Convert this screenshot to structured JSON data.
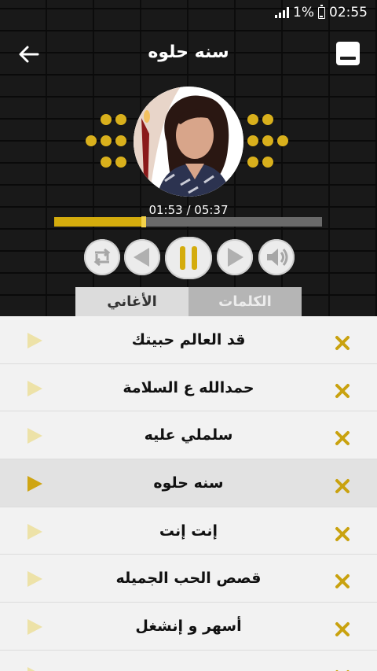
{
  "status_bar": {
    "battery_text": "1%",
    "time": "02:55"
  },
  "header": {
    "title": "سنه حلوه"
  },
  "player": {
    "elapsed": "01:53",
    "duration": "05:37",
    "time_text": "01:53 / 05:37",
    "progress": 0.335
  },
  "controls": {
    "repeat": "repeat-icon",
    "previous": "previous-icon",
    "play_pause": "pause-icon",
    "next": "next-icon",
    "volume": "volume-icon"
  },
  "tabs": {
    "songs": "الأغاني",
    "lyrics": "الكلمات",
    "active": "songs"
  },
  "songs": [
    {
      "title": "قد العالم حبيتك",
      "active": false
    },
    {
      "title": "حمدالله ع السلامة",
      "active": false
    },
    {
      "title": "سلملي عليه",
      "active": false
    },
    {
      "title": "سنه حلوه",
      "active": true
    },
    {
      "title": "إنت إنت",
      "active": false
    },
    {
      "title": "قصص الحب الجميله",
      "active": false
    },
    {
      "title": "أسهر و إنشغل",
      "active": false
    }
  ],
  "colors": {
    "accent": "#d4ac0d",
    "dots": "#d9b01c",
    "header_bg": "#1c1c1c",
    "list_bg": "#f2f2f2",
    "active_row": "#e2e2e2"
  }
}
